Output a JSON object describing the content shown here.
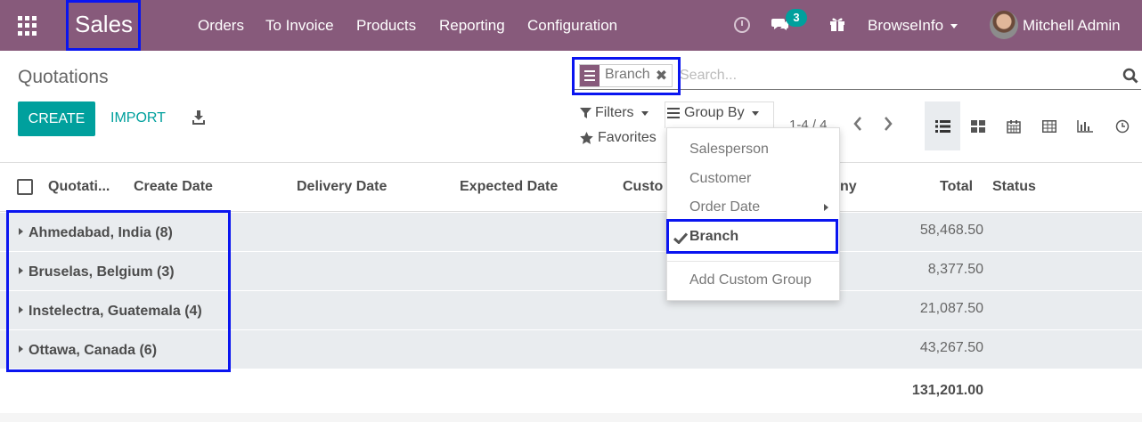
{
  "navbar": {
    "app_name": "Sales",
    "menu": [
      "Orders",
      "To Invoice",
      "Products",
      "Reporting",
      "Configuration"
    ],
    "message_count": "3",
    "company": "BrowseInfo",
    "user": "Mitchell Admin"
  },
  "control": {
    "title": "Quotations",
    "create_label": "CREATE",
    "import_label": "IMPORT",
    "facet_label": "Branch",
    "facet_close": "✖",
    "search_placeholder": "Search...",
    "filters_label": "Filters",
    "groupby_label": "Group By",
    "favorites_label": "Favorites",
    "pager": "1-4 / 4"
  },
  "groupby_menu": {
    "items": [
      "Salesperson",
      "Customer",
      "Order Date",
      "Branch"
    ],
    "selected": "Branch",
    "add_custom": "Add Custom Group"
  },
  "table": {
    "headers": [
      "Quotati...",
      "Create Date",
      "Delivery Date",
      "Expected Date",
      "Custo",
      "ny",
      "Total",
      "Status"
    ],
    "groups": [
      {
        "label": "Ahmedabad, India (8)",
        "total": "58,468.50"
      },
      {
        "label": "Bruselas, Belgium (3)",
        "total": "8,377.50"
      },
      {
        "label": "Instelectra, Guatemala (4)",
        "total": "21,087.50"
      },
      {
        "label": "Ottawa, Canada (6)",
        "total": "43,267.50"
      }
    ],
    "grand_total": "131,201.00"
  },
  "colors": {
    "navbar": "#875a7b",
    "primary": "#00a09d",
    "highlight": "#0a15f0"
  }
}
